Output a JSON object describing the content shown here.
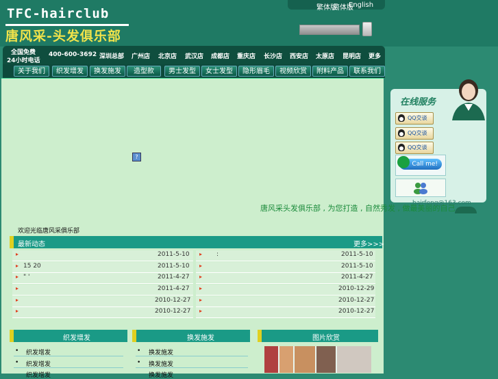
{
  "header": {
    "logo_en": "TFC-hairclub",
    "logo_cn": "唐风采-头发俱乐部",
    "top_links": [
      "繁体版",
      "简体版",
      "English"
    ]
  },
  "storebar": {
    "hotline_line1": "全国免费",
    "hotline_line2": "24小时电话",
    "phone": "400-600-3692",
    "stores": [
      "深圳总部",
      "广州店",
      "北京店",
      "武汉店",
      "成都店",
      "重庆店",
      "长沙店",
      "西安店",
      "太原店",
      "昆明店",
      "更多"
    ]
  },
  "nav": {
    "items": [
      "关于我们",
      "织发增发",
      "换发施发",
      "造型款",
      "男士发型",
      "女士发型",
      "隐形眉毛",
      "视频欣赏",
      "附料产品",
      "联系我们"
    ]
  },
  "banner": {
    "flash_icon": "?",
    "marquee": "唐风采头发俱乐部 , 为您打造 , 自然秀发 , 做最美丽的自己..."
  },
  "welcome": "欢迎光临唐风采俱乐部",
  "news": {
    "title": "最新动态",
    "more": "更多>>>",
    "left": [
      {
        "text": "",
        "date": "2011-5-10"
      },
      {
        "text": "15   20",
        "date": "2011-5-10"
      },
      {
        "text": "\"  '",
        "date": "2011-4-27"
      },
      {
        "text": "",
        "date": "2011-4-27"
      },
      {
        "text": "",
        "date": "2010-12-27"
      },
      {
        "text": "",
        "date": "2010-12-27"
      }
    ],
    "right": [
      {
        "text": ":",
        "date": "2011-5-10"
      },
      {
        "text": "",
        "date": "2011-5-10"
      },
      {
        "text": "",
        "date": "2011-4-27"
      },
      {
        "text": "",
        "date": "2010-12-29"
      },
      {
        "text": "",
        "date": "2010-12-27"
      },
      {
        "text": "",
        "date": "2010-12-27"
      }
    ]
  },
  "sections": [
    {
      "title": "织发增发",
      "items": [
        "织发增发",
        "织发增发",
        "织发增发"
      ]
    },
    {
      "title": "换发施发",
      "items": [
        "换发施发",
        "换发施发",
        "换发施发"
      ]
    },
    {
      "title": "图片欣赏",
      "items": []
    }
  ],
  "service": {
    "title": "在线服务",
    "qq_labels": [
      "QQ交谈",
      "QQ交谈",
      "QQ交谈"
    ],
    "callme": "Call me!",
    "email": "hairfeng@163.com"
  },
  "colors": {
    "page_bg": "#2c8a72",
    "content_bg": "#cdeecd",
    "section_header": "#1a9a86",
    "accent_bar": "#e0d020",
    "logo_cn": "#f2e34a"
  }
}
